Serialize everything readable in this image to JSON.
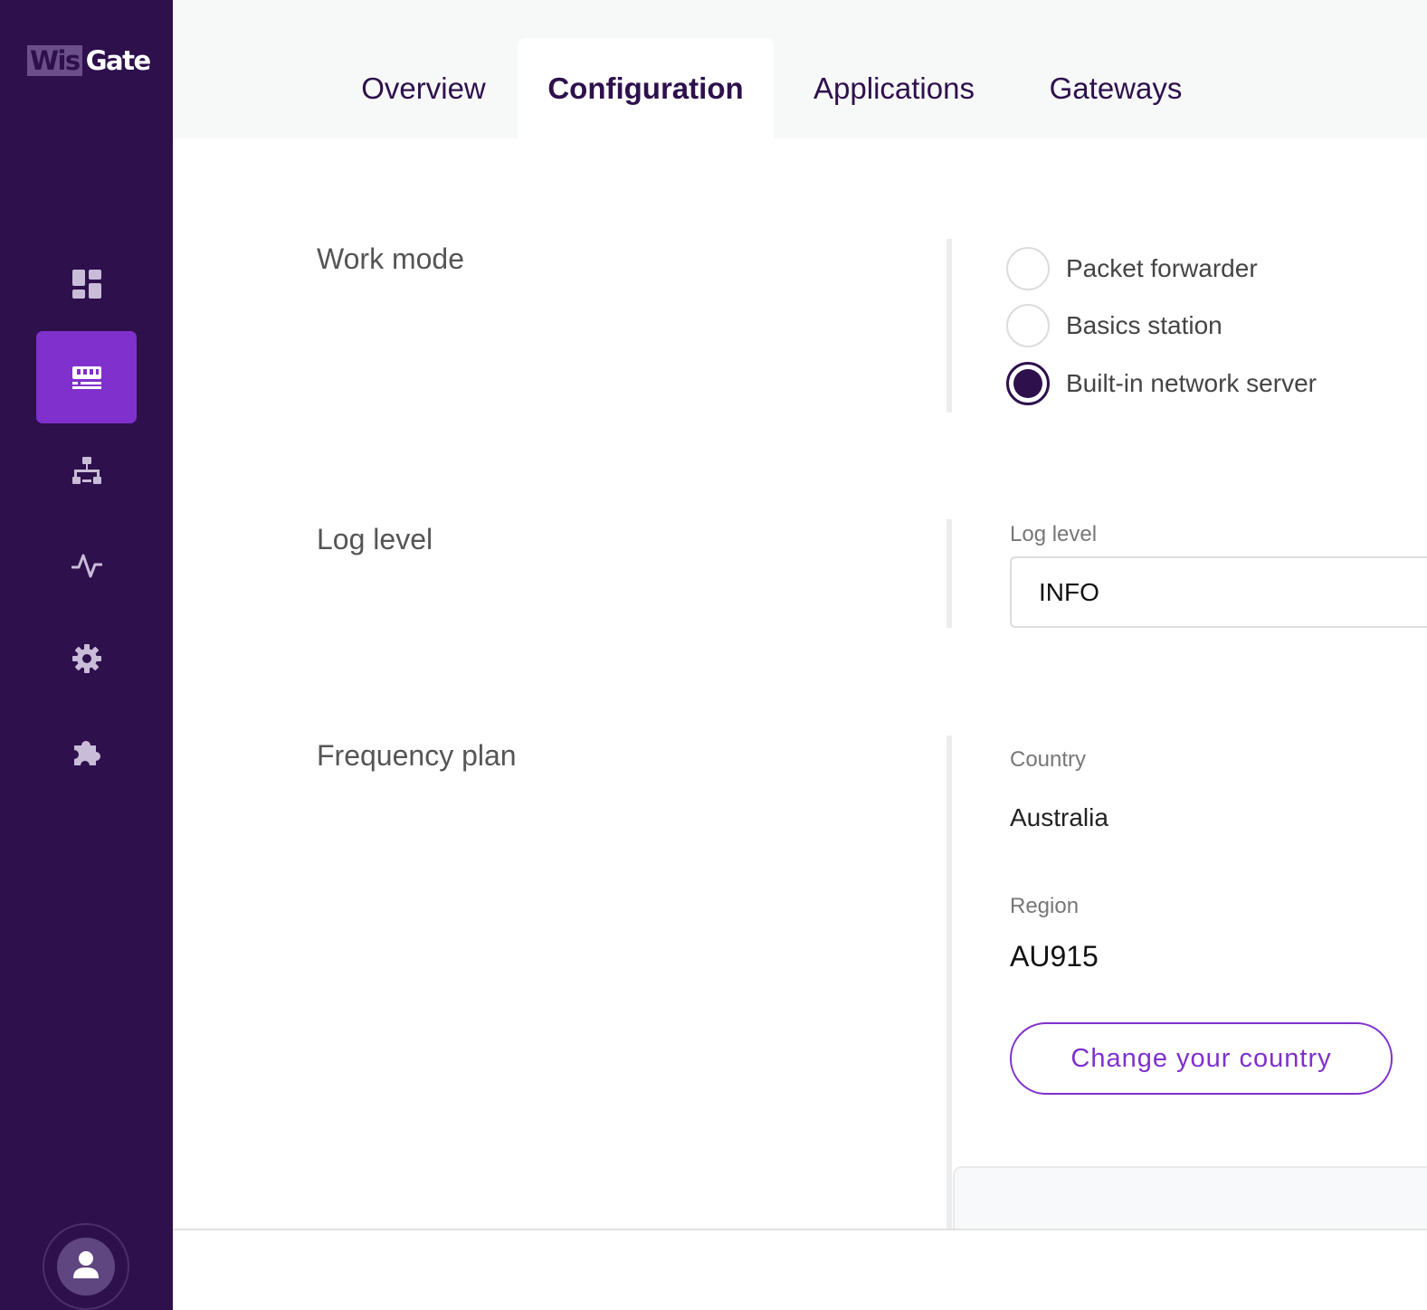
{
  "brand": {
    "logo_part1": "Wis",
    "logo_part2": "Gate"
  },
  "sidebar": {
    "items": [
      {
        "icon": "dashboard-icon",
        "active": false
      },
      {
        "icon": "gateway-icon",
        "active": true
      },
      {
        "icon": "network-icon",
        "active": false
      },
      {
        "icon": "activity-icon",
        "active": false
      },
      {
        "icon": "gear-icon",
        "active": false
      },
      {
        "icon": "puzzle-icon",
        "active": false
      }
    ],
    "user_icon": "user-icon"
  },
  "tabs": [
    {
      "label": "Overview",
      "active": false
    },
    {
      "label": "Configuration",
      "active": true
    },
    {
      "label": "Applications",
      "active": false
    },
    {
      "label": "Gateways",
      "active": false
    }
  ],
  "work_mode": {
    "title": "Work mode",
    "options": [
      {
        "label": "Packet forwarder",
        "checked": false
      },
      {
        "label": "Basics station",
        "checked": false
      },
      {
        "label": "Built-in network server",
        "checked": true
      }
    ]
  },
  "log_level": {
    "title": "Log level",
    "field_label": "Log level",
    "value": "INFO"
  },
  "frequency_plan": {
    "title": "Frequency plan",
    "country_label": "Country",
    "country_value": "Australia",
    "region_label": "Region",
    "region_value": "AU915",
    "change_button": "Change your country"
  },
  "colors": {
    "sidebar_bg": "#2e104d",
    "accent": "#8030cc",
    "primary_text": "#2e104d"
  }
}
